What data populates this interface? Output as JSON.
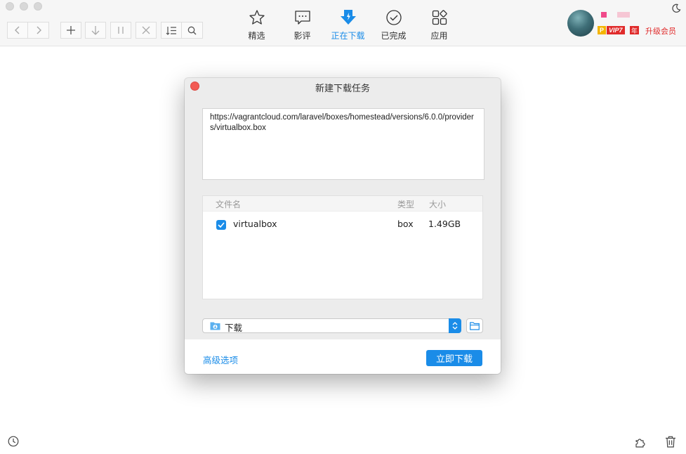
{
  "toolbar": {
    "tabs": [
      {
        "label": "精选",
        "icon": "star-icon"
      },
      {
        "label": "影评",
        "icon": "comment-icon"
      },
      {
        "label": "正在下载",
        "icon": "downloading-icon"
      },
      {
        "label": "已完成",
        "icon": "check-circle-icon"
      },
      {
        "label": "应用",
        "icon": "apps-icon"
      }
    ],
    "active_tab": "正在下载",
    "user": {
      "badge_p": "P",
      "badge_vip": "VIP7",
      "badge_year": "年",
      "upgrade_label": "升级会员"
    }
  },
  "dialog": {
    "title": "新建下载任务",
    "url": "https://vagrantcloud.com/laravel/boxes/homestead/versions/6.0.0/providers/virtualbox.box",
    "table": {
      "headers": {
        "name": "文件名",
        "type": "类型",
        "size": "大小"
      },
      "rows": [
        {
          "checked": true,
          "name": "virtualbox",
          "type": "box",
          "size": "1.49GB"
        }
      ]
    },
    "save_path": "下载",
    "advanced_label": "高级选项",
    "download_label": "立即下载"
  },
  "colors": {
    "accent": "#1a8ce8",
    "vip_red": "#e02b2b",
    "close_red": "#f25b54"
  }
}
